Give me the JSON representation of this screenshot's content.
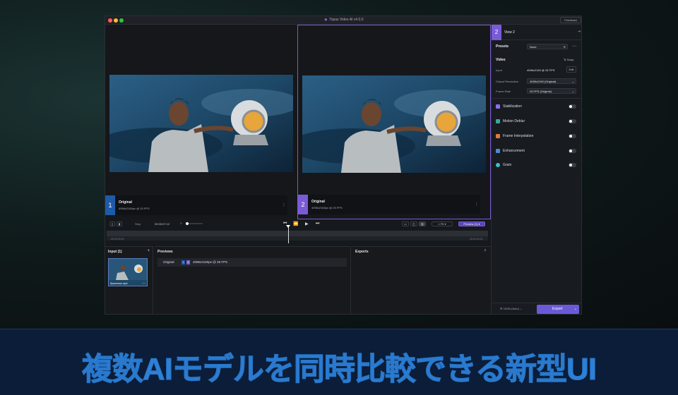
{
  "app": {
    "title": "Topaz Video AI  v4.0.0",
    "feedback_label": "Feedback"
  },
  "views": [
    {
      "num": "1",
      "title": "Original",
      "subtitle": "4096x2160px @ 25 FPS",
      "color": "#1e5aa8"
    },
    {
      "num": "2",
      "title": "Original",
      "subtitle": "4096x2160px @ 25 FPS",
      "color": "#7a5bd6"
    }
  ],
  "controls": {
    "step_label": "Step",
    "timecode": "00:00:07:12",
    "zoom_label": "Fit",
    "preview_label": "Preview (1)",
    "time_start": "00:00:00:00",
    "time_end": "00:00:15:00"
  },
  "panels": {
    "input_title": "Input (1)",
    "input_thumb_name": "Spaceman.mp4",
    "previews_title": "Previews",
    "preview_row_label": "Original",
    "preview_row_info": "4096x2160px @ 25 FPS",
    "exports_title": "Exports"
  },
  "sidebar": {
    "view_num": "2",
    "view_title": "View 2",
    "presets_label": "Presets",
    "presets_value": "None",
    "video_label": "Video",
    "swap_label": "Swap",
    "input_label": "Input",
    "input_value": "4096x2160 @ 25 FPS",
    "edit_label": "Edit",
    "output_res_label": "Output Resolution",
    "output_res_value": "4096x2160 (Original)",
    "frame_rate_label": "Frame Rate",
    "frame_rate_value": "25 FPS (Original)",
    "features": [
      {
        "name": "Stabilization",
        "color": "#8a6ff0"
      },
      {
        "name": "Motion Deblur",
        "color": "#3aa6a0"
      },
      {
        "name": "Frame Interpolation",
        "color": "#e07a3a"
      },
      {
        "name": "Enhancement",
        "color": "#4a8ad6"
      },
      {
        "name": "Grain",
        "color": "#3ac0c8"
      }
    ],
    "gpu_label": "10GB (Auto)",
    "export_label": "Export"
  },
  "banner": {
    "text": "複数AIモデルを同時比較できる新型UI"
  }
}
